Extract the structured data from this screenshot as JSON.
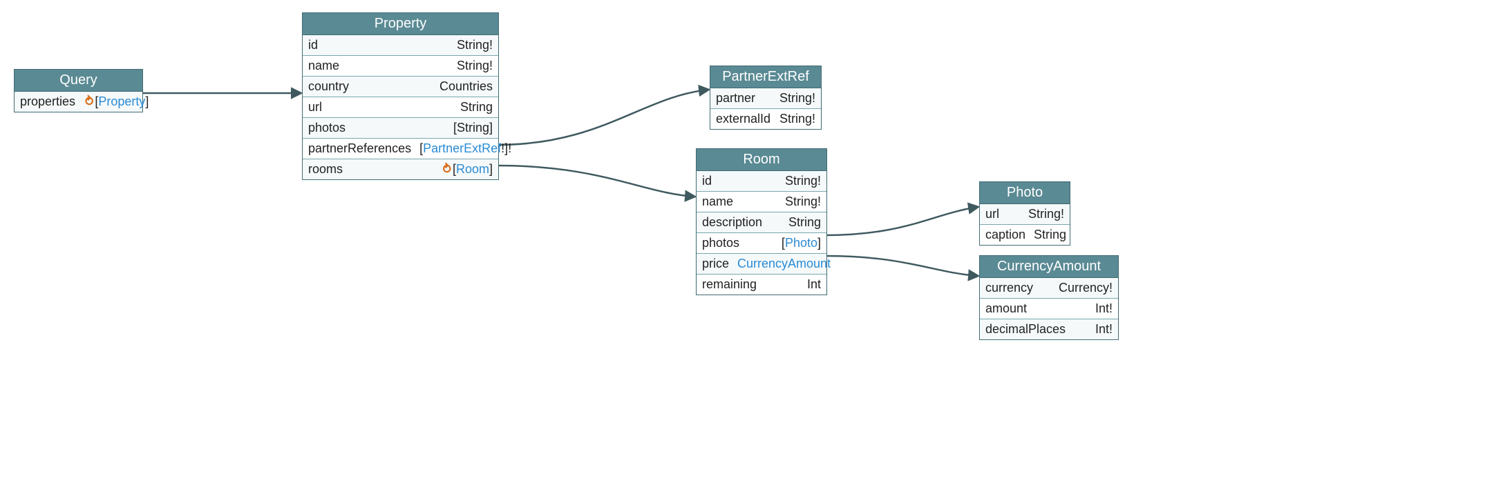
{
  "colors": {
    "header_bg": "#5a8a94",
    "header_text": "#ffffff",
    "border": "#3f6a73",
    "link": "#2a8bd4",
    "pagination_icon": "#d96f1e",
    "edge": "#3f5a5f"
  },
  "entities": {
    "query": {
      "title": "Query",
      "fields": {
        "properties": {
          "name": "properties",
          "type_link": "Property",
          "brackets": true,
          "paginated": true
        }
      }
    },
    "property": {
      "title": "Property",
      "fields": {
        "id": {
          "name": "id",
          "type": "String!"
        },
        "name": {
          "name": "name",
          "type": "String!"
        },
        "country": {
          "name": "country",
          "type": "Countries"
        },
        "url": {
          "name": "url",
          "type": "String"
        },
        "photos": {
          "name": "photos",
          "type": "[String]"
        },
        "partnerReferences": {
          "name": "partnerReferences",
          "type_link": "PartnerExtRef",
          "link_suffix": "!",
          "brackets": true,
          "outer_suffix": "!"
        },
        "rooms": {
          "name": "rooms",
          "type_link": "Room",
          "brackets": true,
          "paginated": true
        }
      }
    },
    "partnerExtRef": {
      "title": "PartnerExtRef",
      "fields": {
        "partner": {
          "name": "partner",
          "type": "String!"
        },
        "externalId": {
          "name": "externalId",
          "type": "String!"
        }
      }
    },
    "room": {
      "title": "Room",
      "fields": {
        "id": {
          "name": "id",
          "type": "String!"
        },
        "name": {
          "name": "name",
          "type": "String!"
        },
        "description": {
          "name": "description",
          "type": "String"
        },
        "photos": {
          "name": "photos",
          "type_link": "Photo",
          "brackets": true
        },
        "price": {
          "name": "price",
          "type_link": "CurrencyAmount"
        },
        "remaining": {
          "name": "remaining",
          "type": "Int"
        }
      }
    },
    "photo": {
      "title": "Photo",
      "fields": {
        "url": {
          "name": "url",
          "type": "String!"
        },
        "caption": {
          "name": "caption",
          "type": "String"
        }
      }
    },
    "currencyAmount": {
      "title": "CurrencyAmount",
      "fields": {
        "currency": {
          "name": "currency",
          "type": "Currency!"
        },
        "amount": {
          "name": "amount",
          "type": "Int!"
        },
        "decimalPlaces": {
          "name": "decimalPlaces",
          "type": "Int!"
        }
      }
    }
  }
}
